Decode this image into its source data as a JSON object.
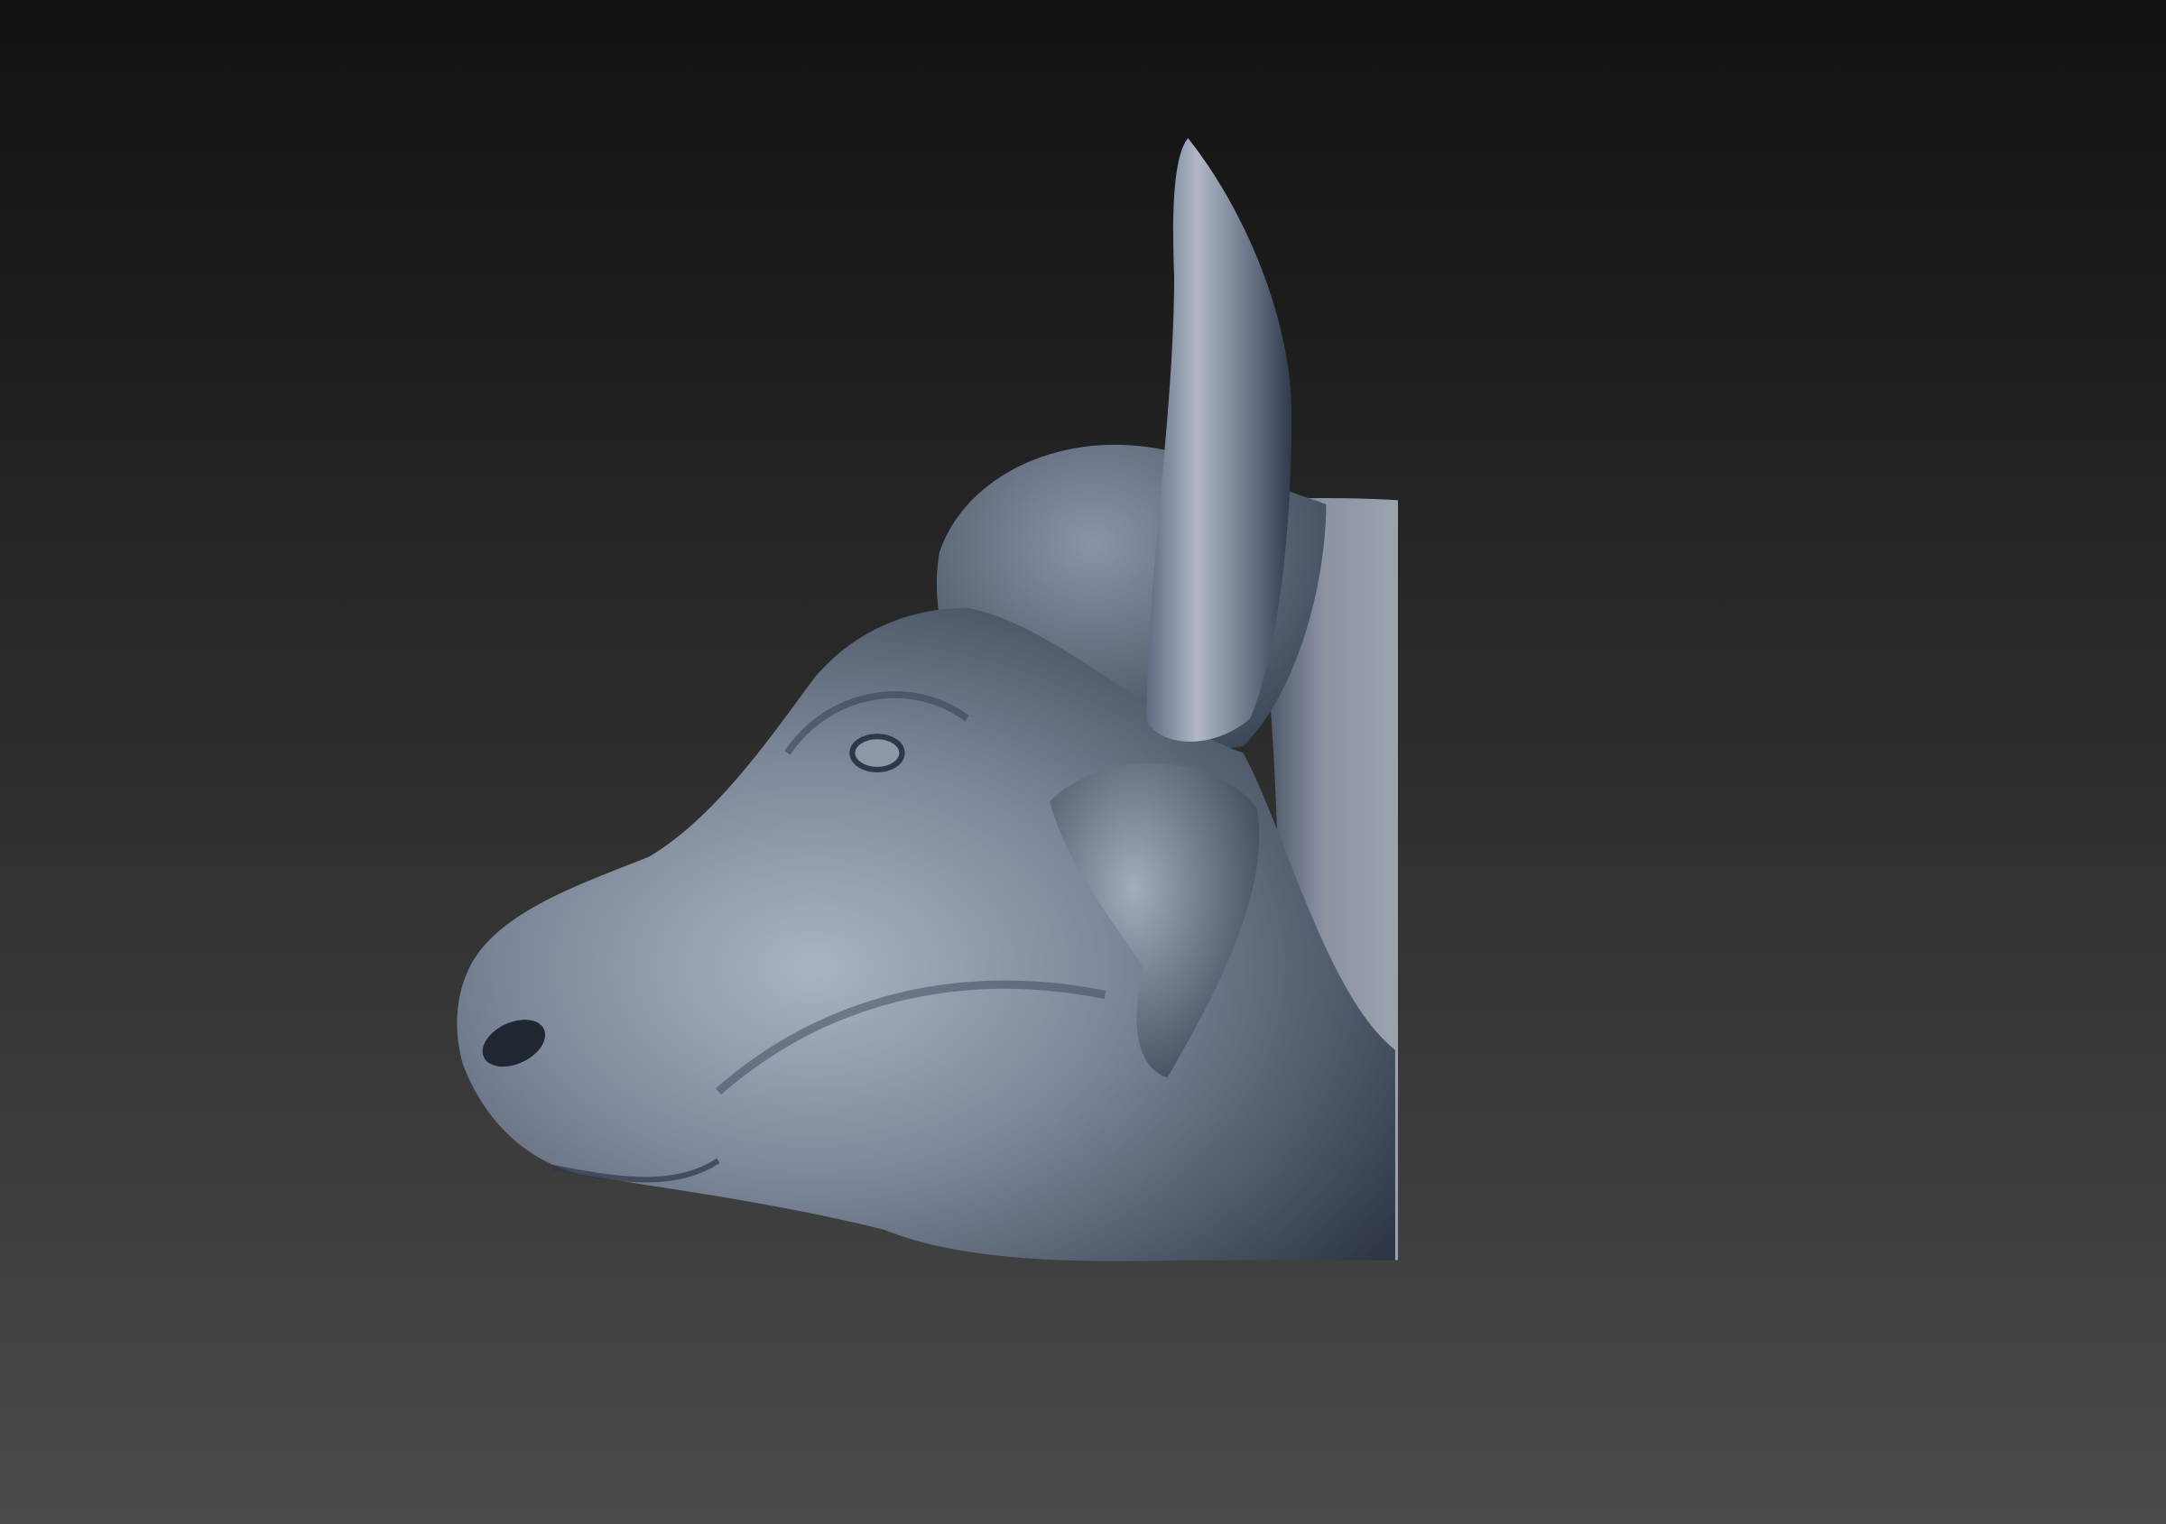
{
  "colors": {
    "background_top": "#111111",
    "background_bottom": "#4a4a4a",
    "model_base": "#67758a",
    "model_highlight": "#a9b4c2",
    "model_shadow": "#2c3646"
  }
}
